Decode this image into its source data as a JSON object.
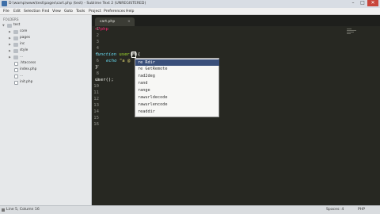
{
  "window": {
    "title": "D:\\wamp\\www\\test\\pages\\cart.php (test) - Sublime Text 2 (UNREGISTERED)",
    "controls": [
      "–",
      "□",
      "✕"
    ]
  },
  "menu": [
    "File",
    "Edit",
    "Selection",
    "Find",
    "View",
    "Goto",
    "Tools",
    "Project",
    "Preferences",
    "Help"
  ],
  "sidebar": {
    "label": "FOLDERS",
    "items": [
      {
        "label": "test",
        "kind": "folder",
        "depth": 0,
        "expanded": true
      },
      {
        "label": "core",
        "kind": "folder",
        "depth": 1,
        "expanded": false
      },
      {
        "label": "pages",
        "kind": "folder",
        "depth": 1,
        "expanded": false
      },
      {
        "label": "inc",
        "kind": "folder",
        "depth": 1,
        "expanded": false
      },
      {
        "label": "style",
        "kind": "folder",
        "depth": 1,
        "expanded": false
      },
      {
        "label": "...",
        "kind": "folder",
        "depth": 1,
        "expanded": false
      },
      {
        "label": ".htaccess",
        "kind": "file",
        "depth": 1
      },
      {
        "label": "index.php",
        "kind": "file",
        "depth": 1
      },
      {
        "label": "...",
        "kind": "file",
        "depth": 1
      },
      {
        "label": "init.php",
        "kind": "file",
        "depth": 1
      }
    ]
  },
  "tab": {
    "label": "cart.php",
    "close": "×"
  },
  "editor": {
    "line_numbers": [
      "1",
      "2",
      "3",
      "4",
      "5",
      "6",
      "7",
      "8",
      "9",
      "10",
      "11",
      "12",
      "13",
      "14",
      "15",
      "16"
    ],
    "lines": {
      "l1": "<?php",
      "l5_kw": "function",
      "l5_name": "user",
      "l5_open": "(",
      "l5_arg": "M",
      "l5_close": "){",
      "l6_echo": "echo",
      "l6_str": "\"a @",
      "l7": "}",
      "l9": "user();"
    }
  },
  "autocomplete": {
    "items": [
      "rewind",
      "rename",
      "rmdir",
      "rad2deg",
      "rand",
      "range",
      "rawurldecode",
      "rawurlencode",
      "readdir"
    ],
    "selected_index": 0,
    "labels_shown": [
      "re Rdir",
      "re GetRemote",
      "rad2deg",
      "rand",
      "range",
      "rawurldecode",
      "rawurlencode",
      "readdir"
    ]
  },
  "status": {
    "left": "Line 5, Column 16",
    "spaces": "Spaces: 4",
    "syntax": "PHP"
  },
  "colors": {
    "editor_bg": "#272822",
    "keyword": "#f92672",
    "function": "#a6e22e",
    "storage": "#66d9ef",
    "string": "#e6db74"
  }
}
